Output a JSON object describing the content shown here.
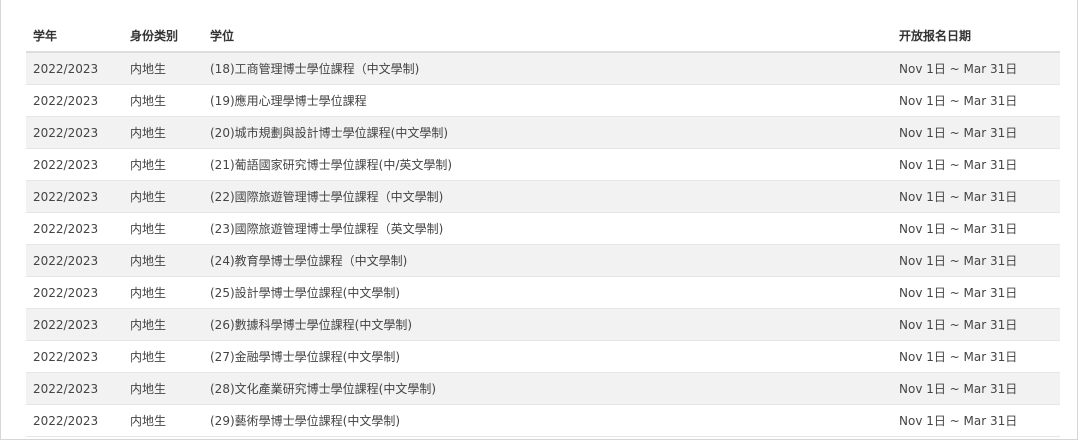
{
  "table": {
    "headers": {
      "year": "学年",
      "identity": "身份类别",
      "degree": "学位",
      "open_date": "开放报名日期"
    },
    "rows": [
      {
        "year": "2022/2023",
        "identity": "内地生",
        "degree": "(18)工商管理博士學位課程（中文學制)",
        "open_date": "Nov 1日 ~ Mar 31日"
      },
      {
        "year": "2022/2023",
        "identity": "内地生",
        "degree": "(19)應用心理學博士學位課程",
        "open_date": "Nov 1日 ~ Mar 31日"
      },
      {
        "year": "2022/2023",
        "identity": "内地生",
        "degree": "(20)城市規劃與設計博士學位課程(中文學制)",
        "open_date": "Nov 1日 ~ Mar 31日"
      },
      {
        "year": "2022/2023",
        "identity": "内地生",
        "degree": "(21)葡語國家研究博士學位課程(中/英文學制)",
        "open_date": "Nov 1日 ~ Mar 31日"
      },
      {
        "year": "2022/2023",
        "identity": "内地生",
        "degree": "(22)國際旅遊管理博士學位課程（中文學制)",
        "open_date": "Nov 1日 ~ Mar 31日"
      },
      {
        "year": "2022/2023",
        "identity": "内地生",
        "degree": "(23)國際旅遊管理博士學位課程（英文學制)",
        "open_date": "Nov 1日 ~ Mar 31日"
      },
      {
        "year": "2022/2023",
        "identity": "内地生",
        "degree": "(24)教育學博士學位課程（中文學制)",
        "open_date": "Nov 1日 ~ Mar 31日"
      },
      {
        "year": "2022/2023",
        "identity": "内地生",
        "degree": "(25)設計學博士學位課程(中文學制)",
        "open_date": "Nov 1日 ~ Mar 31日"
      },
      {
        "year": "2022/2023",
        "identity": "内地生",
        "degree": "(26)數據科學博士學位課程(中文學制)",
        "open_date": "Nov 1日 ~ Mar 31日"
      },
      {
        "year": "2022/2023",
        "identity": "内地生",
        "degree": "(27)金融學博士學位課程(中文學制)",
        "open_date": "Nov 1日 ~ Mar 31日"
      },
      {
        "year": "2022/2023",
        "identity": "内地生",
        "degree": "(28)文化產業研究博士學位課程(中文學制)",
        "open_date": "Nov 1日 ~ Mar 31日"
      },
      {
        "year": "2022/2023",
        "identity": "内地生",
        "degree": "(29)藝術學博士學位課程(中文學制)",
        "open_date": "Nov 1日 ~ Mar 31日"
      }
    ]
  }
}
